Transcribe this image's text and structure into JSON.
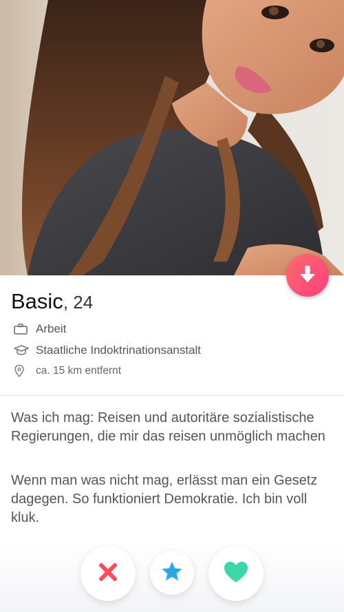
{
  "profile": {
    "name": "Basic",
    "age": ", 24",
    "job": "Arbeit",
    "school": "Staatliche Indoktrinationsanstalt",
    "distance": "ca. 15 km entfernt"
  },
  "bio": {
    "paragraph1": "Was ich mag: Reisen und autoritäre sozialistische Regierungen, die mir das reisen unmöglich machen",
    "paragraph2": "Wenn man was nicht mag, erlässt man ein Gesetz dagegen. So funktioniert Demokratie. Ich bin voll kluk."
  },
  "icons": {
    "job": "briefcase-icon",
    "school": "graduation-cap-icon",
    "distance": "location-pin-icon",
    "collapse": "arrow-down-icon",
    "nope": "x-icon",
    "super_like": "star-icon",
    "like": "heart-icon"
  },
  "colors": {
    "collapse_button": "#ff4b6e",
    "nope": "#ff4d5e",
    "super_like": "#2aa7e8",
    "like": "#3cd6a8"
  }
}
